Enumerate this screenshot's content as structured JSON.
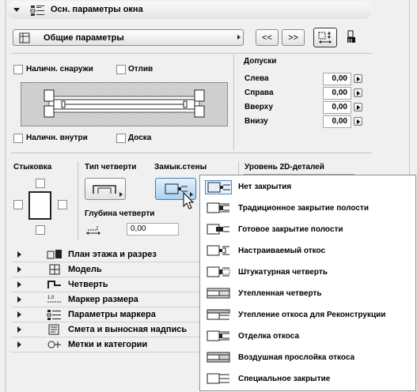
{
  "header": {
    "title": "Осн. параметры окна"
  },
  "params_bar": {
    "dropdown_label": "Общие параметры",
    "prev_label": "<<",
    "next_label": ">>"
  },
  "options": {
    "outside": "Наличн. снаружи",
    "sill": "Отлив",
    "inside": "Наличн. внутри",
    "board": "Доска"
  },
  "tolerances": {
    "title": "Допуски",
    "rows": [
      {
        "label": "Слева",
        "value": "0,00"
      },
      {
        "label": "Справа",
        "value": "0,00"
      },
      {
        "label": "Вверху",
        "value": "0,00"
      },
      {
        "label": "Внизу",
        "value": "0,00"
      }
    ]
  },
  "lower": {
    "joint_label": "Стыковка",
    "rebate_type_label": "Тип четверти",
    "wall_closure_label": "Замык.стены",
    "detail_level_label": "Уровень 2D-деталей",
    "rebate_depth_label": "Глубина четверти",
    "rebate_depth_value": "0,00"
  },
  "sections": [
    {
      "label": "План этажа и разрез",
      "icon": "floor-plan-icon"
    },
    {
      "label": "Модель",
      "icon": "model-icon"
    },
    {
      "label": "Четверть",
      "icon": "rebate-icon"
    },
    {
      "label": "Маркер размера",
      "icon": "dimension-marker-icon"
    },
    {
      "label": "Параметры маркера",
      "icon": "marker-params-icon"
    },
    {
      "label": "Смета и выносная надпись",
      "icon": "listing-icon"
    },
    {
      "label": "Метки и категории",
      "icon": "tags-icon"
    }
  ],
  "closure_menu": {
    "selected_index": 0,
    "items": [
      "Нет закрытия",
      "Традиционное закрытие полости",
      "Готовое закрытие полости",
      "Настраиваемый откос",
      "Штукатурная четверть",
      "Утепленная четверть",
      "Утепление откоса для Реконструкции",
      "Отделка откоса",
      "Воздушная прослойка откоса",
      "Специальное закрытие"
    ]
  }
}
